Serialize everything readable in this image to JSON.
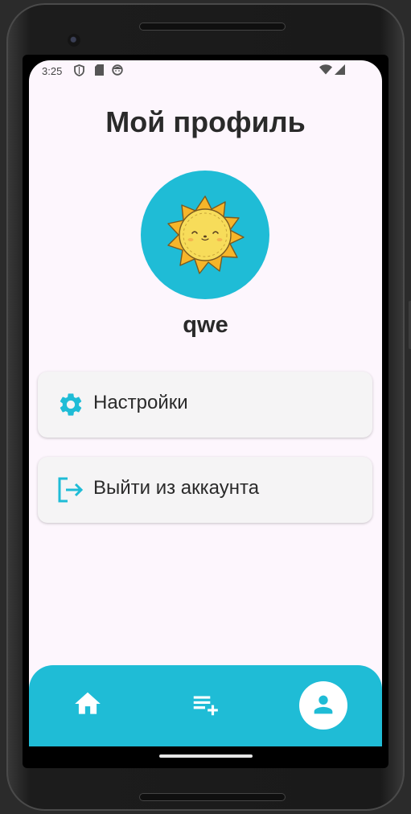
{
  "status_bar": {
    "time": "3:25",
    "left_icons": [
      "shield-icon",
      "sd-card-icon",
      "face-icon"
    ],
    "right_icons": [
      "wifi-icon",
      "cellular-icon"
    ]
  },
  "page": {
    "title": "Мой профиль",
    "username": "qwe",
    "avatar_icon": "sun-icon"
  },
  "menu": [
    {
      "label": "Настройки",
      "icon": "gear-icon"
    },
    {
      "label": "Выйти из аккаунта",
      "icon": "logout-icon"
    }
  ],
  "bottom_nav": {
    "items": [
      "home-icon",
      "playlist-add-icon",
      "profile-icon"
    ],
    "active": "profile-icon"
  },
  "colors": {
    "accent": "#1fbcd6",
    "background": "#fdf6fd",
    "card": "#f5f4f5",
    "text": "#2a2a2a"
  }
}
